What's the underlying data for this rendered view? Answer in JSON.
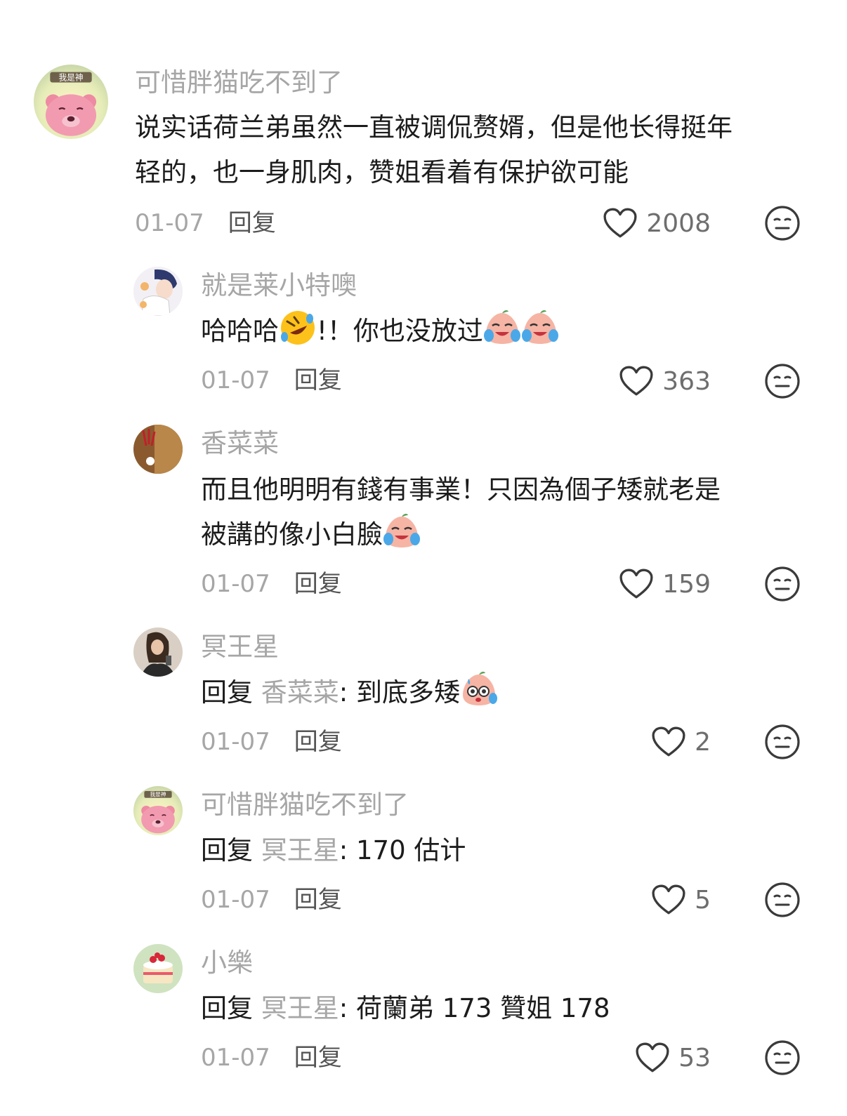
{
  "comments": [
    {
      "username": "可惜胖猫吃不到了",
      "avatar_badge": "我是神",
      "text_line1": "说实话荷兰弟虽然一直被调侃赘婿，但是他长得挺年",
      "text_line2": "轻的，也一身肌肉，赞姐看着有保护欲可能",
      "date": "01-07",
      "reply_label": "回复",
      "likes": "2008"
    },
    {
      "username": "就是莱小特噢",
      "text_a": "哈哈哈",
      "text_b": "!！你也没放过",
      "date": "01-07",
      "reply_label": "回复",
      "likes": "363"
    },
    {
      "username": "香菜菜",
      "text_line1": "而且他明明有錢有事業！只因為個子矮就老是",
      "text_line2": "被講的像小白臉",
      "date": "01-07",
      "reply_label": "回复",
      "likes": "159"
    },
    {
      "username": "冥王星",
      "reply_prefix": "回复",
      "reply_target": "香菜菜",
      "text": ": 到底多矮",
      "date": "01-07",
      "reply_label": "回复",
      "likes": "2"
    },
    {
      "username": "可惜胖猫吃不到了",
      "avatar_badge": "我是神",
      "reply_prefix": "回复",
      "reply_target": "冥王星",
      "text": ": 170 估计",
      "date": "01-07",
      "reply_label": "回复",
      "likes": "5"
    },
    {
      "username": "小樂",
      "reply_prefix": "回复",
      "reply_target": "冥王星",
      "text": ": 荷蘭弟 173 贊姐 178",
      "date": "01-07",
      "reply_label": "回复",
      "likes": "53"
    }
  ],
  "icons": {
    "like": "heart-outline-icon",
    "dislike": "neutral-face-icon",
    "emoji_laugh": "rofl-emoji",
    "emoji_cry": "crying-peach-emoji",
    "emoji_sweat": "sweating-peach-emoji"
  },
  "colors": {
    "username": "#a6a6a6",
    "text": "#1c1c1c",
    "icon": "#333333"
  }
}
